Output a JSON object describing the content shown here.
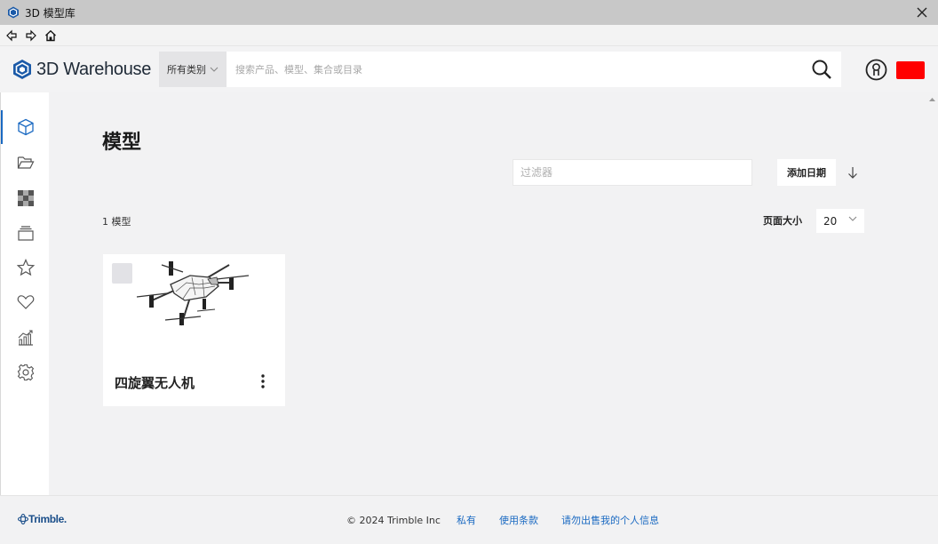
{
  "window": {
    "title": "3D 模型库"
  },
  "header": {
    "logo_text": "3D Warehouse",
    "category_label": "所有类别",
    "search_placeholder": "搜索产品、模型、集合或目录"
  },
  "sidebar": {
    "items": [
      {
        "icon": "cube-icon",
        "active": true
      },
      {
        "icon": "folder-icon"
      },
      {
        "icon": "material-icon"
      },
      {
        "icon": "collection-icon"
      },
      {
        "icon": "star-icon"
      },
      {
        "icon": "heart-icon"
      },
      {
        "icon": "analytics-icon"
      },
      {
        "icon": "gear-icon"
      }
    ]
  },
  "main": {
    "title": "模型",
    "filter_placeholder": "过滤器",
    "sort_label": "添加日期",
    "count_text": "1 模型",
    "page_size_label": "页面大小",
    "page_size_value": "20",
    "cards": [
      {
        "title": "四旋翼无人机",
        "thumbnail": "quadcopter-drone"
      }
    ]
  },
  "footer": {
    "brand": "Trimble.",
    "copyright": "© 2024 Trimble Inc",
    "links": [
      "私有",
      "使用条款",
      "请勿出售我的个人信息"
    ]
  },
  "colors": {
    "accent": "#1b6ac2",
    "user_chip": "#ff0000",
    "background": "#f2f2f3"
  }
}
